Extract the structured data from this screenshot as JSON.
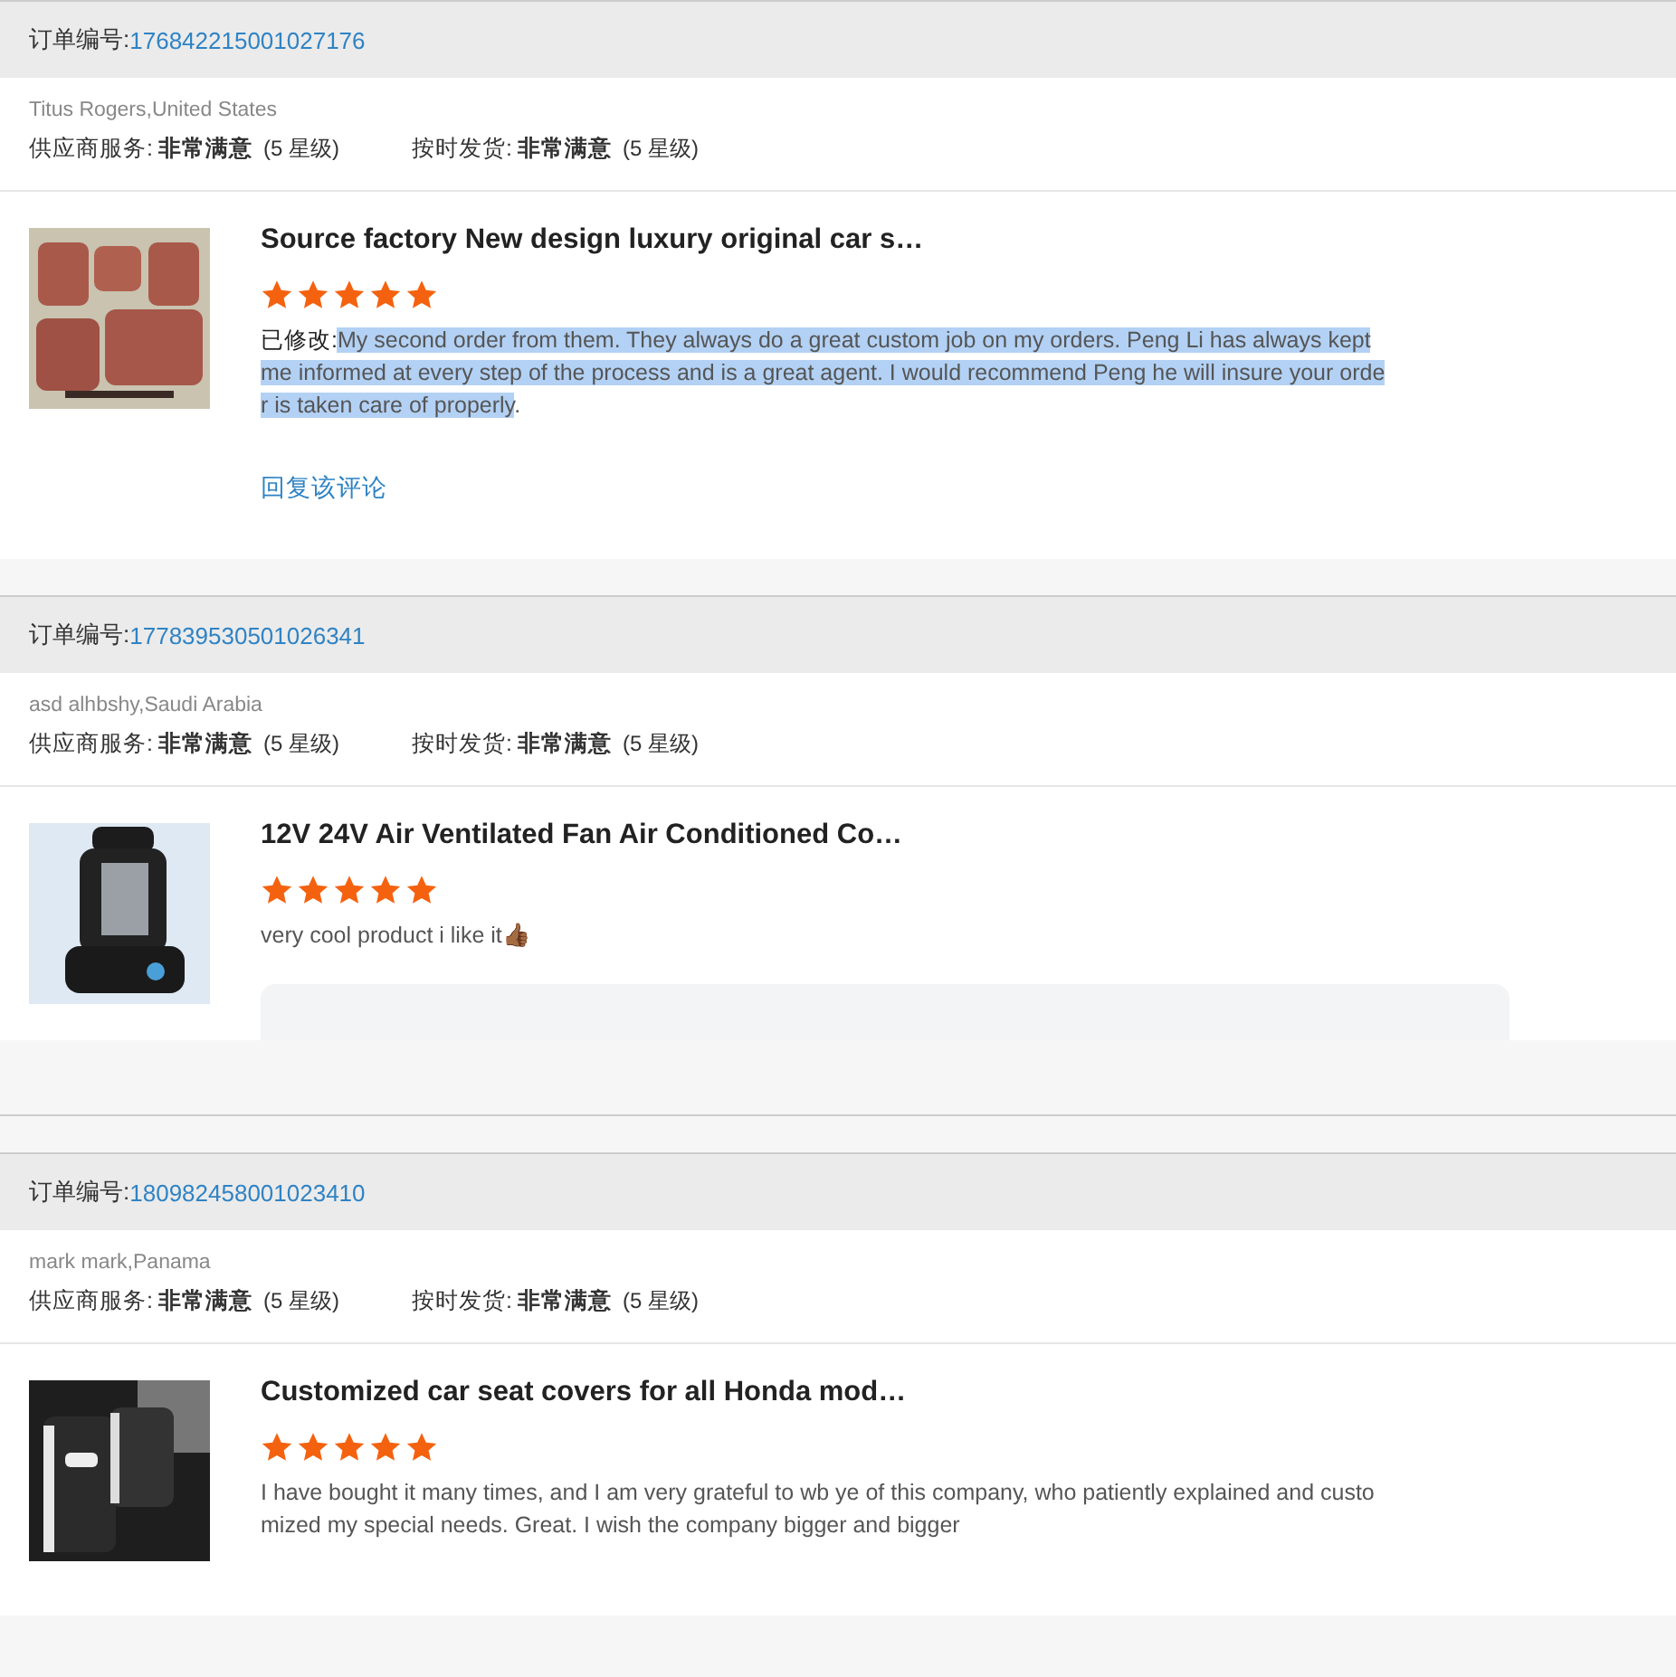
{
  "orders": [
    {
      "order_label": "订单编号:",
      "order_number": "176842215001027176",
      "buyer": "Titus Rogers,United States",
      "ratings": [
        {
          "label": "供应商服务:",
          "value": "非常满意",
          "level": "(5 星级)"
        },
        {
          "label": "按时发货:",
          "value": "非常满意",
          "level": "(5 星级)"
        }
      ],
      "product_title": "Source factory New design luxury original car s…",
      "kind": "picture",
      "stars": 5,
      "review_prefix": "已修改:",
      "review": [
        {
          "text": "My second order from them. They always do a great custom job on my orders. Peng Li has always kept me informed at every step of the process and is a great agent. I would recommend Peng he will insure your order is taken care of properly",
          "selected": true
        },
        {
          "text": ".",
          "selected": false
        }
      ],
      "reply_link": "回复该评论",
      "clipped": false
    },
    {
      "order_label": "订单编号:",
      "order_number": "177839530501026341",
      "buyer": "asd alhbshy,Saudi Arabia",
      "ratings": [
        {
          "label": "供应商服务:",
          "value": "非常满意",
          "level": "(5 星级)"
        },
        {
          "label": "按时发货:",
          "value": "非常满意",
          "level": "(5 星级)"
        }
      ],
      "product_title": "12V 24V Air Ventilated Fan Air Conditioned Co…",
      "kind": "picture",
      "stars": 5,
      "review": [
        {
          "text": "very cool product i like it👍🏾",
          "selected": false
        }
      ],
      "clipped": true
    },
    {
      "order_label": "订单编号:",
      "order_number": "180982458001023410",
      "buyer": "mark mark,Panama",
      "ratings": [
        {
          "label": "供应商服务:",
          "value": "非常满意",
          "level": "(5 星级)"
        },
        {
          "label": "按时发货:",
          "value": "非常满意",
          "level": "(5 星级)"
        }
      ],
      "product_title": "Customized car seat covers for all Honda mod…",
      "kind": "picture",
      "stars": 5,
      "review": [
        {
          "text": "I have bought it many times, and I am very grateful to wb ye of this company, who patiently explained and customized my special needs. Great. I wish the company bigger and bigger",
          "selected": false
        }
      ],
      "clipped": false
    }
  ]
}
